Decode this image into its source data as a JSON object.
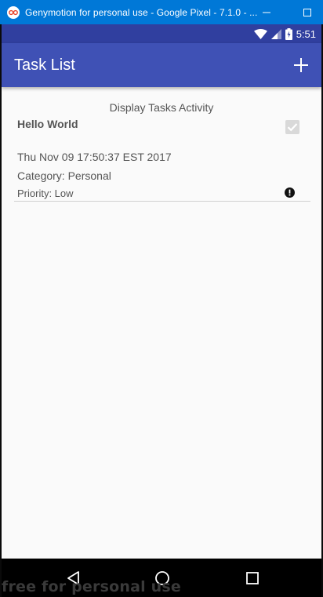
{
  "window": {
    "title": "Genymotion for personal use - Google Pixel - 7.1.0 - ...",
    "logo_icon": "genymotion-logo-icon",
    "minimize_icon": "minimize-icon",
    "maximize_icon": "maximize-icon"
  },
  "status_bar": {
    "time": "5:51",
    "icons": [
      "wifi-icon",
      "signal-icon",
      "battery-icon"
    ],
    "color": "#303f9f"
  },
  "app_bar": {
    "title": "Task List",
    "action_icon": "add-icon",
    "color": "#3f51b5"
  },
  "content": {
    "activity_label": "Display Tasks Activity",
    "tasks": [
      {
        "title": "Hello World",
        "completed": true,
        "date": "Thu Nov 09 17:50:37 EST 2017",
        "category": "Category: Personal",
        "priority": "Priority: Low",
        "priority_icon": "alert-icon"
      }
    ]
  },
  "nav_bar": {
    "buttons": [
      "back-icon",
      "home-icon",
      "recents-icon"
    ],
    "watermark": "free for personal use"
  }
}
